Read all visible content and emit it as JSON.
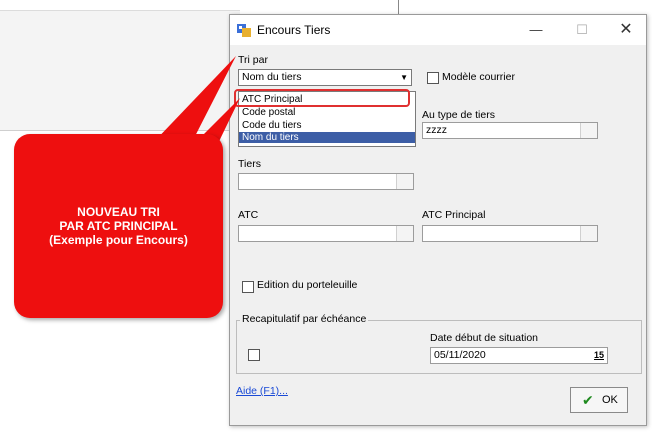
{
  "dialog": {
    "title": "Encours Tiers",
    "controls": {
      "minimize": "—",
      "maximize": "☐",
      "close": "✕"
    }
  },
  "form": {
    "tri_par_label": "Tri par",
    "tri_par_value": "Nom du tiers",
    "tri_options": [
      "ATC Principal",
      "Code postal",
      "Code du tiers",
      "Nom du tiers"
    ],
    "tri_selected_index": 3,
    "modele_courrier_label": "Modèle courrier",
    "au_type_label": "Au type de tiers",
    "au_type_value": "zzzz",
    "tiers_label": "Tiers",
    "tiers_value": "",
    "atc_label": "ATC",
    "atc_value": "",
    "atc_principal_label": "ATC Principal",
    "atc_principal_value": "",
    "edition_label": "Edition du porteleuille",
    "recap_label": "Recapitulatif par échéance",
    "date_label": "Date début de situation",
    "date_value": "05/11/2020",
    "calendar_glyph": "15"
  },
  "footer": {
    "aide_label": "Aide (F1)...",
    "ok_label": "OK"
  },
  "callout": {
    "lines": [
      "NOUVEAU TRI",
      "PAR ATC PRINCIPAL",
      "(Exemple pour Encours)"
    ],
    "color": "#ee0f0f"
  },
  "icons": {
    "title_icon": "app-icon",
    "ok_icon": "checkmark-icon"
  }
}
